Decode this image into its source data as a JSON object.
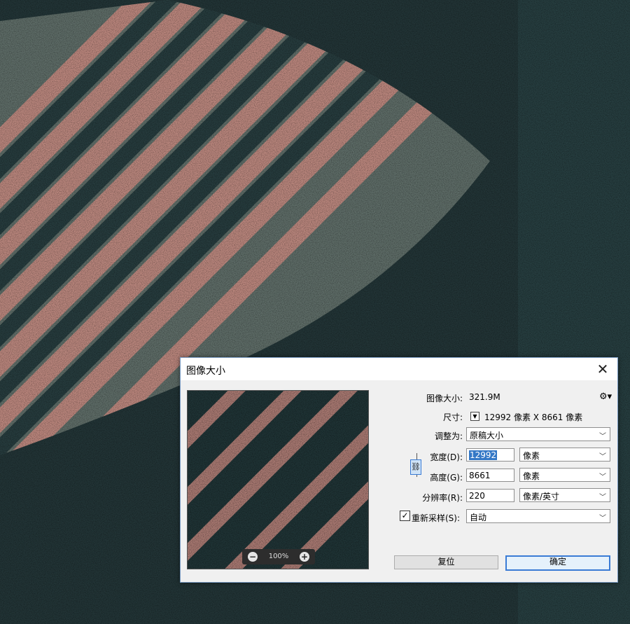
{
  "dialog": {
    "title": "图像大小",
    "close_label": "✕",
    "image_size_label": "图像大小:",
    "image_size_value": "321.9M",
    "dimensions_label": "尺寸:",
    "dimensions_value": "12992 像素  X  8661 像素",
    "fit_to_label": "调整为:",
    "fit_to_value": "原稿大小",
    "width_label": "宽度(D):",
    "width_value": "12992",
    "width_unit": "像素",
    "height_label": "高度(G):",
    "height_value": "8661",
    "height_unit": "像素",
    "resolution_label": "分辨率(R):",
    "resolution_value": "220",
    "resolution_unit": "像素/英寸",
    "resample_label": "重新采样(S):",
    "resample_checked": "✓",
    "resample_value": "自动",
    "reset_button": "复位",
    "ok_button": "确定",
    "zoom_level": "100%",
    "zoom_out": "−",
    "zoom_in": "+"
  },
  "colors": {
    "background": "#223436",
    "stripe": "#c98a80",
    "accent": "#3a7bd5"
  },
  "icons": [
    "gear-icon",
    "close-icon",
    "chevron-down-icon",
    "link-icon",
    "zoom-in-icon",
    "zoom-out-icon"
  ]
}
